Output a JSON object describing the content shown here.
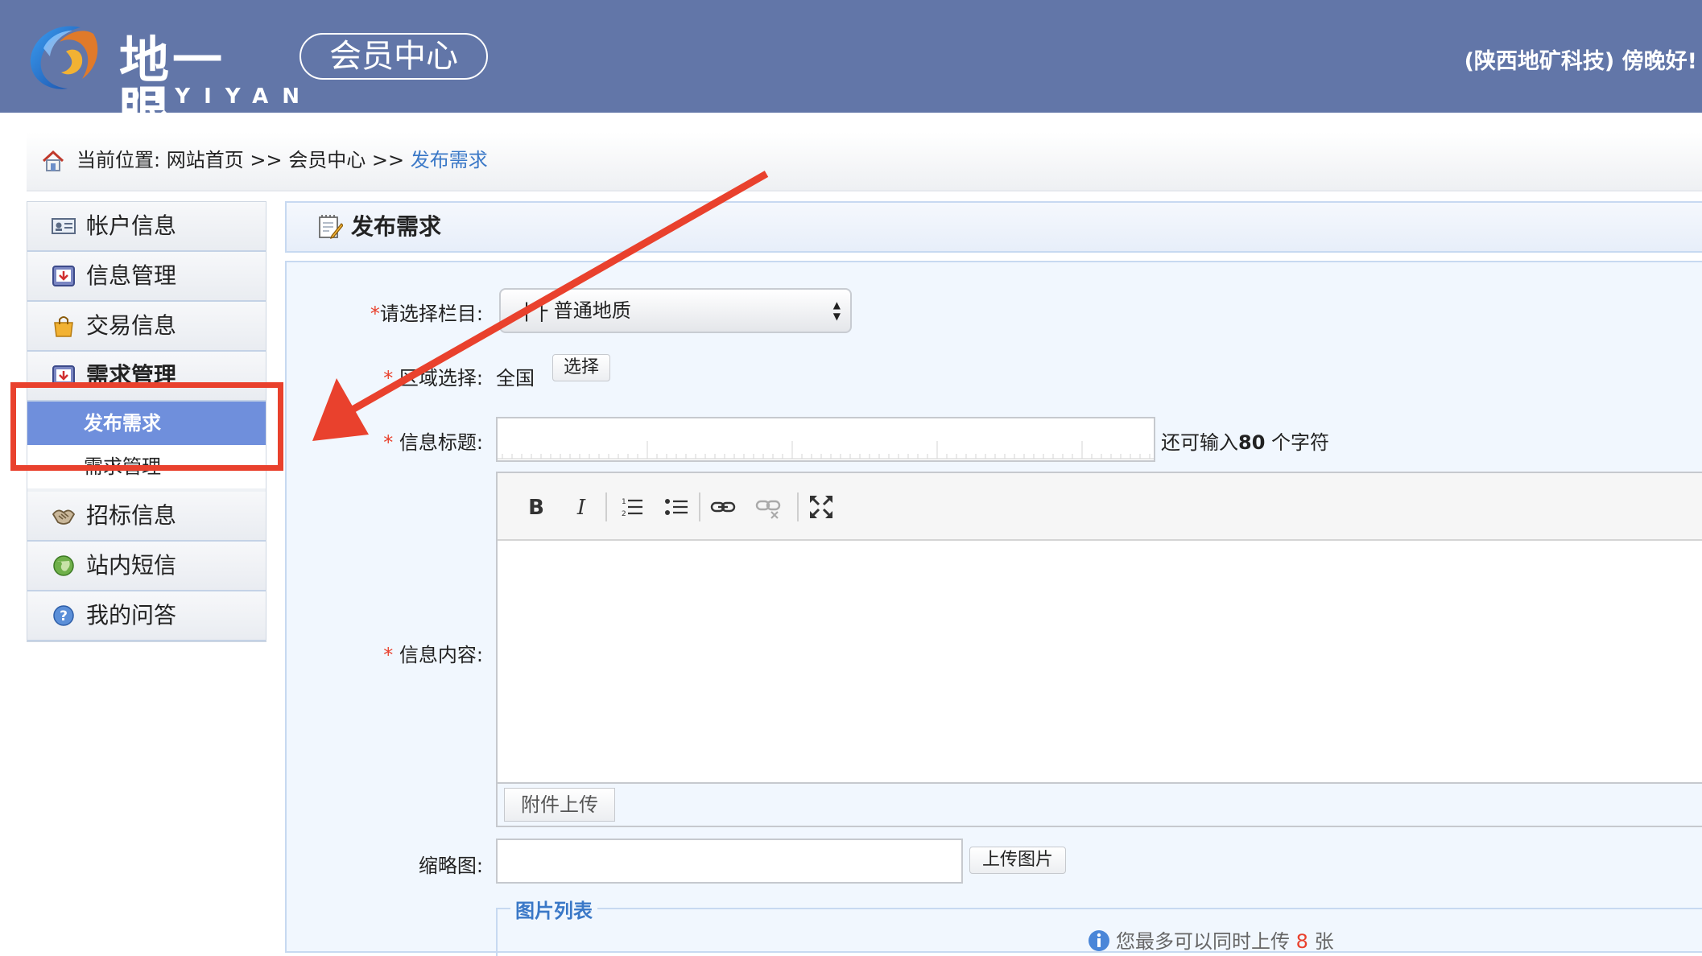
{
  "header": {
    "logo_text": "地一眼",
    "logo_sub": "DIYIYAN",
    "member_center": "会员中心",
    "greeting": "(陕西地矿科技) 傍晚好!"
  },
  "breadcrumb": {
    "prefix": "当前位置:",
    "home": "网站首页",
    "sep": ">>",
    "member": "会员中心",
    "current": "发布需求"
  },
  "sidebar": {
    "items": [
      {
        "label": "帐户信息",
        "icon": "id-card-icon"
      },
      {
        "label": "信息管理",
        "icon": "envelope-icon"
      },
      {
        "label": "交易信息",
        "icon": "shopping-bag-icon"
      },
      {
        "label": "需求管理",
        "icon": "envelope-icon"
      },
      {
        "label": "招标信息",
        "icon": "handshake-icon"
      },
      {
        "label": "站内短信",
        "icon": "globe-icon"
      },
      {
        "label": "我的问答",
        "icon": "help-icon"
      }
    ],
    "sub_items": [
      {
        "label": "发布需求",
        "active": true
      },
      {
        "label": "需求管理",
        "active": false
      }
    ]
  },
  "panel": {
    "title": "发布需求",
    "category_label": "请选择栏目:",
    "category_value": "| ├ 普通地质",
    "region_label": "区域选择:",
    "region_value": "全国",
    "region_button": "选择",
    "title_label": "信息标题:",
    "char_hint_prefix": "还可输入",
    "char_hint_count": "80",
    "char_hint_suffix": " 个字符",
    "content_label": "信息内容:",
    "attach_button": "附件上传",
    "thumb_label": "缩略图:",
    "upload_button": "上传图片",
    "image_list_legend": "图片列表",
    "upload_tip_prefix": "您最多可以同时上传",
    "upload_tip_count": "8",
    "upload_tip_suffix": "张"
  },
  "colors": {
    "header_bg": "#6276a8",
    "accent_link": "#3a78c7",
    "active_menu": "#6f8fdc",
    "annotation_red": "#e9412d"
  }
}
